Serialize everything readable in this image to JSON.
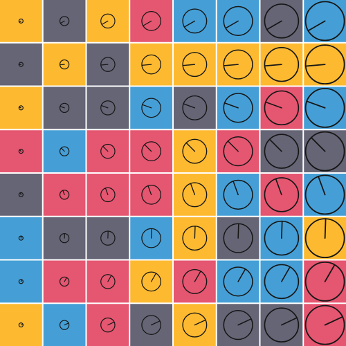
{
  "palette": {
    "yellow": "#FDBA31",
    "slate": "#656576",
    "blue": "#459FD6",
    "red": "#E55671",
    "stroke": "#161616",
    "gap": "#ffffff"
  },
  "grid": {
    "rows": 8,
    "cols": 8,
    "cells": [
      [
        "yellow",
        "slate",
        "yellow",
        "red",
        "blue",
        "blue",
        "slate",
        "blue"
      ],
      [
        "slate",
        "yellow",
        "slate",
        "yellow",
        "yellow",
        "yellow",
        "yellow",
        "yellow"
      ],
      [
        "yellow",
        "slate",
        "slate",
        "blue",
        "slate",
        "blue",
        "red",
        "blue"
      ],
      [
        "red",
        "blue",
        "red",
        "red",
        "yellow",
        "red",
        "slate",
        "slate"
      ],
      [
        "slate",
        "red",
        "red",
        "red",
        "yellow",
        "blue",
        "red",
        "blue"
      ],
      [
        "blue",
        "slate",
        "slate",
        "blue",
        "yellow",
        "slate",
        "blue",
        "yellow"
      ],
      [
        "blue",
        "red",
        "red",
        "yellow",
        "red",
        "blue",
        "blue",
        "red"
      ],
      [
        "yellow",
        "blue",
        "red",
        "slate",
        "yellow",
        "slate",
        "slate",
        "red"
      ]
    ],
    "dial_icon": "clock-dial-icon",
    "dial_scale_by_column": [
      1,
      2,
      3,
      4,
      5,
      6,
      7,
      8
    ],
    "hand_angle_deg_by_row": [
      -150,
      -175,
      160,
      135,
      110,
      88,
      60,
      25
    ]
  }
}
